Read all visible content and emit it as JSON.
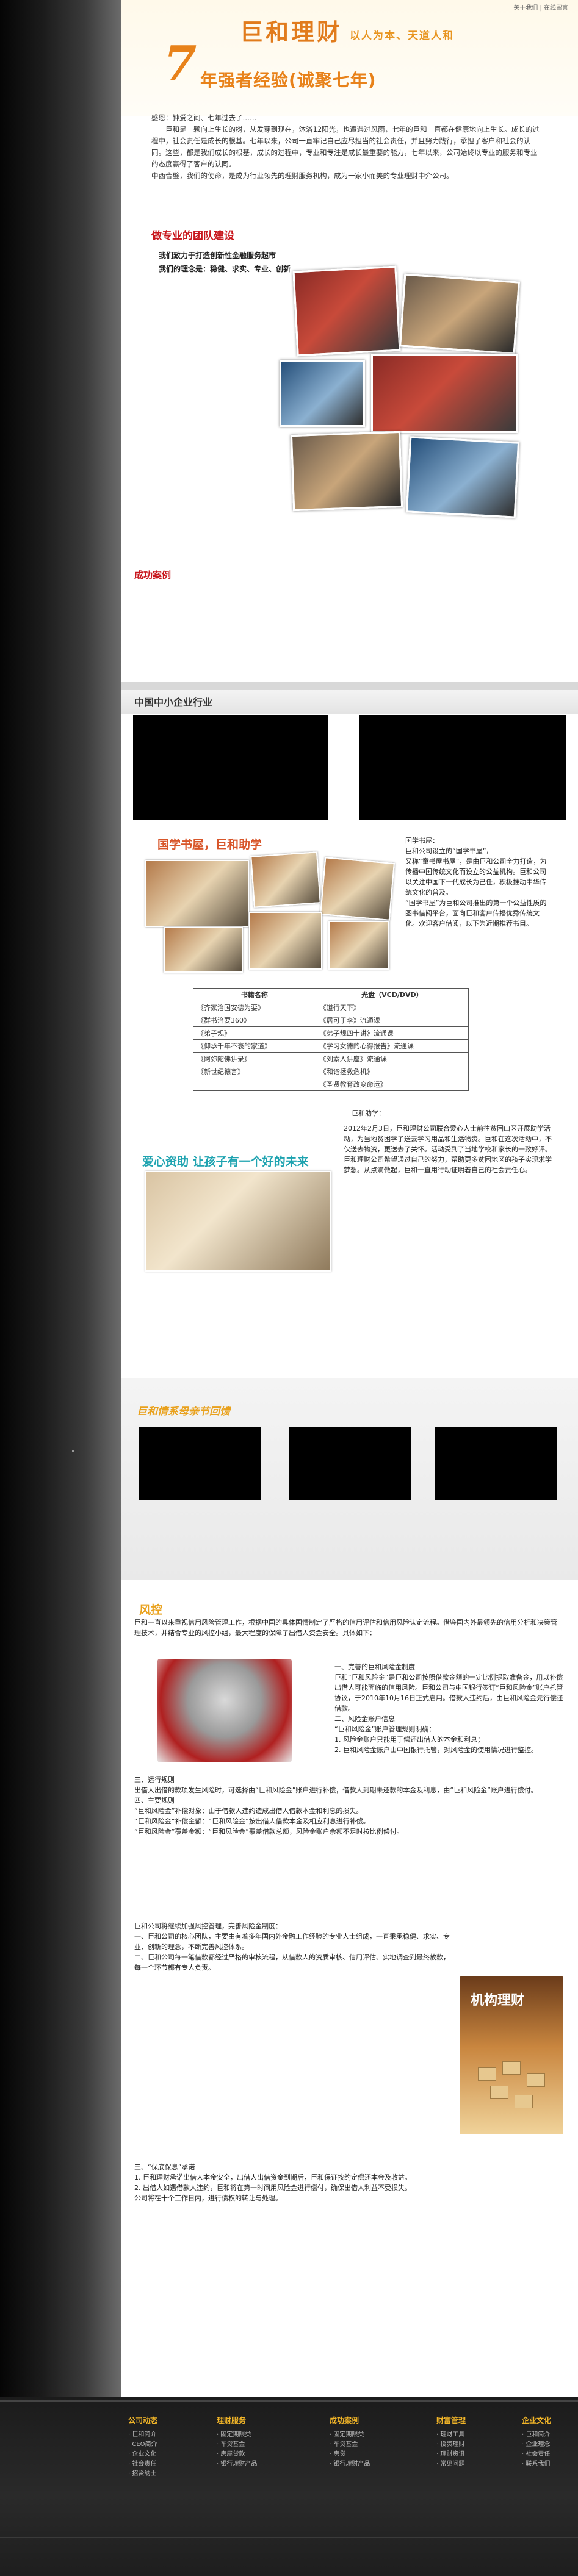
{
  "header": {
    "top_links": "关于我们 | 在线留言",
    "logo": "巨和理财",
    "slogan": "以人为本、天道人和",
    "seven": "7",
    "anniversary": "年强者经验(诚聚七年)"
  },
  "intro": [
    "感恩：钟爱之间、七年过去了……",
    "巨和是一颗向上生长的树，从发芽到现在，沐浴12阳光，也遭遇过风雨，七年的巨和一直都在健康地向上生长。成长的过程中，社会责任是成长的根基。七年以来，公司一直牢记自己应尽担当的社会责任，并且努力践行，承担了客户和社会的认同。这些，都是我们成长的根基，成长的过程中，专业和专注是成长最重要的能力，七年以来，公司始终以专业的服务和专业的态度赢得了客户的认同。",
    "中西合璧，我们的使命，是成为行业领先的理财服务机构，成为一家小而美的专业理财中介公司。"
  ],
  "team_section": "做专业的团队建设",
  "motto": [
    "我们致力于打造创新性金融服务超市",
    "我们的理念是：稳健、求实、专业、创新"
  ],
  "success_title": "成功案例",
  "sme_title": "中国中小企业行业",
  "guoxue": {
    "title": "国学书屋，巨和助学",
    "text": [
      "国学书屋：",
      "巨和公司设立的“国学书屋”，",
      "又称“童书屋书屋”，是由巨和公司全力打造，为传播中国传统文化而设立的公益机构。巨和公司以关注中国下一代成长为己任，积极推动中华传统文化的普及。",
      "“国学书屋”为巨和公司推出的第一个公益性质的图书借阅平台，面向巨和客户传播优秀传统文化。欢迎客户借阅，以下为近期推荐书目。"
    ]
  },
  "books": {
    "headers": [
      "书籍名称",
      "光盘（VCD/DVD）"
    ],
    "rows": [
      [
        "《齐家治国安德为要》",
        "《道行天下》"
      ],
      [
        "《群书治要360》",
        "《居可于李》流通课"
      ],
      [
        "《弟子规》",
        "《弟子规四十讲》流通课"
      ],
      [
        "《仰承千年不衰的家道》",
        "《学习女德的心得报告》流通课"
      ],
      [
        "《阿弥陀佛讲录》",
        "《刘素人讲座》流通课"
      ],
      [
        "《新世纪德言》",
        "《和谐拯救危机》"
      ],
      [
        "",
        "《圣贤教育改变命运》"
      ]
    ]
  },
  "help": {
    "label": "巨和助学：",
    "title": "爱心资助 让孩子有一个好的未来",
    "text": "2012年2月3日，巨和理财公司联合爱心人士前往贫困山区开展助学活动，为当地贫困学子送去学习用品和生活物资。巨和在这次活动中，不仅送去物资，更送去了关怀。活动受到了当地学校和家长的一致好评。巨和理财公司希望通过自己的努力，帮助更多贫困地区的孩子实现求学梦想。从点滴做起，巨和一直用行动证明着自己的社会责任心。"
  },
  "mother_title": "巨和情系母亲节回馈",
  "risk": {
    "title": "风控",
    "intro": "巨和一直以来重视信用风险管理工作，根据中国的具体国情制定了严格的信用评估和信用风险认定流程。借鉴国内外最领先的信用分析和决策管理技术，并结合专业的风控小组，最大程度的保障了出借人资金安全。具体如下：",
    "lock_text": "一、完善的巨和风险金制度\n巨和“巨和风险金”是巨和公司按照借款金额的一定比例提取准备金，用以补偿出借人可能面临的信用风险。巨和公司与中国银行签订“巨和风险金”账户托管协议，于2010年10月16日正式启用。借款人违约后，由巨和风险金先行偿还借款。\n二、风险金账户信息\n“巨和风险金”账户管理规则明确：\n1. 风险金账户只能用于偿还出借人的本金和利息；\n2. 巨和风险金账户由中国银行托管，对风险金的使用情况进行监控。",
    "body": "三、运行规则\n出借人出借的款项发生风险时，可选择由“巨和风险金”账户进行补偿，借款人到期未还款的本金及利息，由“巨和风险金”账户进行偿付。\n四、主要规则\n“巨和风险金”补偿对象：由于借款人违约造成出借人借款本金和利息的损失。\n“巨和风险金”补偿金额：“巨和风险金”按出借人借款本金及相应利息进行补偿。\n“巨和风险金”覆盖金额：“巨和风险金”覆盖借款总额，风险金账户余额不足时按比例偿付。",
    "body2": "巨和公司将继续加强风控管理，完善风险金制度：\n一、巨和公司的核心团队，主要由有着多年国内外金融工作经验的专业人士组成，一直秉承稳健、求实、专业、创新的理念，不断完善风控体系。\n二、巨和公司每一笔借款都经过严格的审核流程，从借款人的资质审核、信用评估、实地调查到最终放款，每一个环节都有专人负责。",
    "org_title": "机构理财",
    "body3": "三、“保底保息”承诺\n1. 巨和理财承诺出借人本金安全，出借人出借资金到期后，巨和保证按约定偿还本金及收益。\n2. 出借人如遇借款人违约，巨和将在第一时间用风险金进行偿付，确保出借人利益不受损失。\n公司将在十个工作日内，进行债权的转让与处理。"
  },
  "footer": {
    "columns": [
      {
        "title": "公司动态",
        "items": [
          "巨和简介",
          "CEO简介",
          "企业文化",
          "社会责任",
          "招贤纳士"
        ]
      },
      {
        "title": "理财服务",
        "items": [
          "固定期限类",
          "车贷基金",
          "房屋贷款",
          "银行理财产品"
        ]
      },
      {
        "title": "成功案例",
        "items": [
          "固定期限类",
          "车贷基金",
          "房贷",
          "银行理财产品"
        ]
      },
      {
        "title": "财富管理",
        "items": [
          "理财工具",
          "投资理财",
          "理财资讯",
          "常见问题"
        ]
      },
      {
        "title": "企业文化",
        "items": [
          "巨和简介",
          "企业理念",
          "社会责任",
          "联系我们"
        ]
      }
    ]
  }
}
